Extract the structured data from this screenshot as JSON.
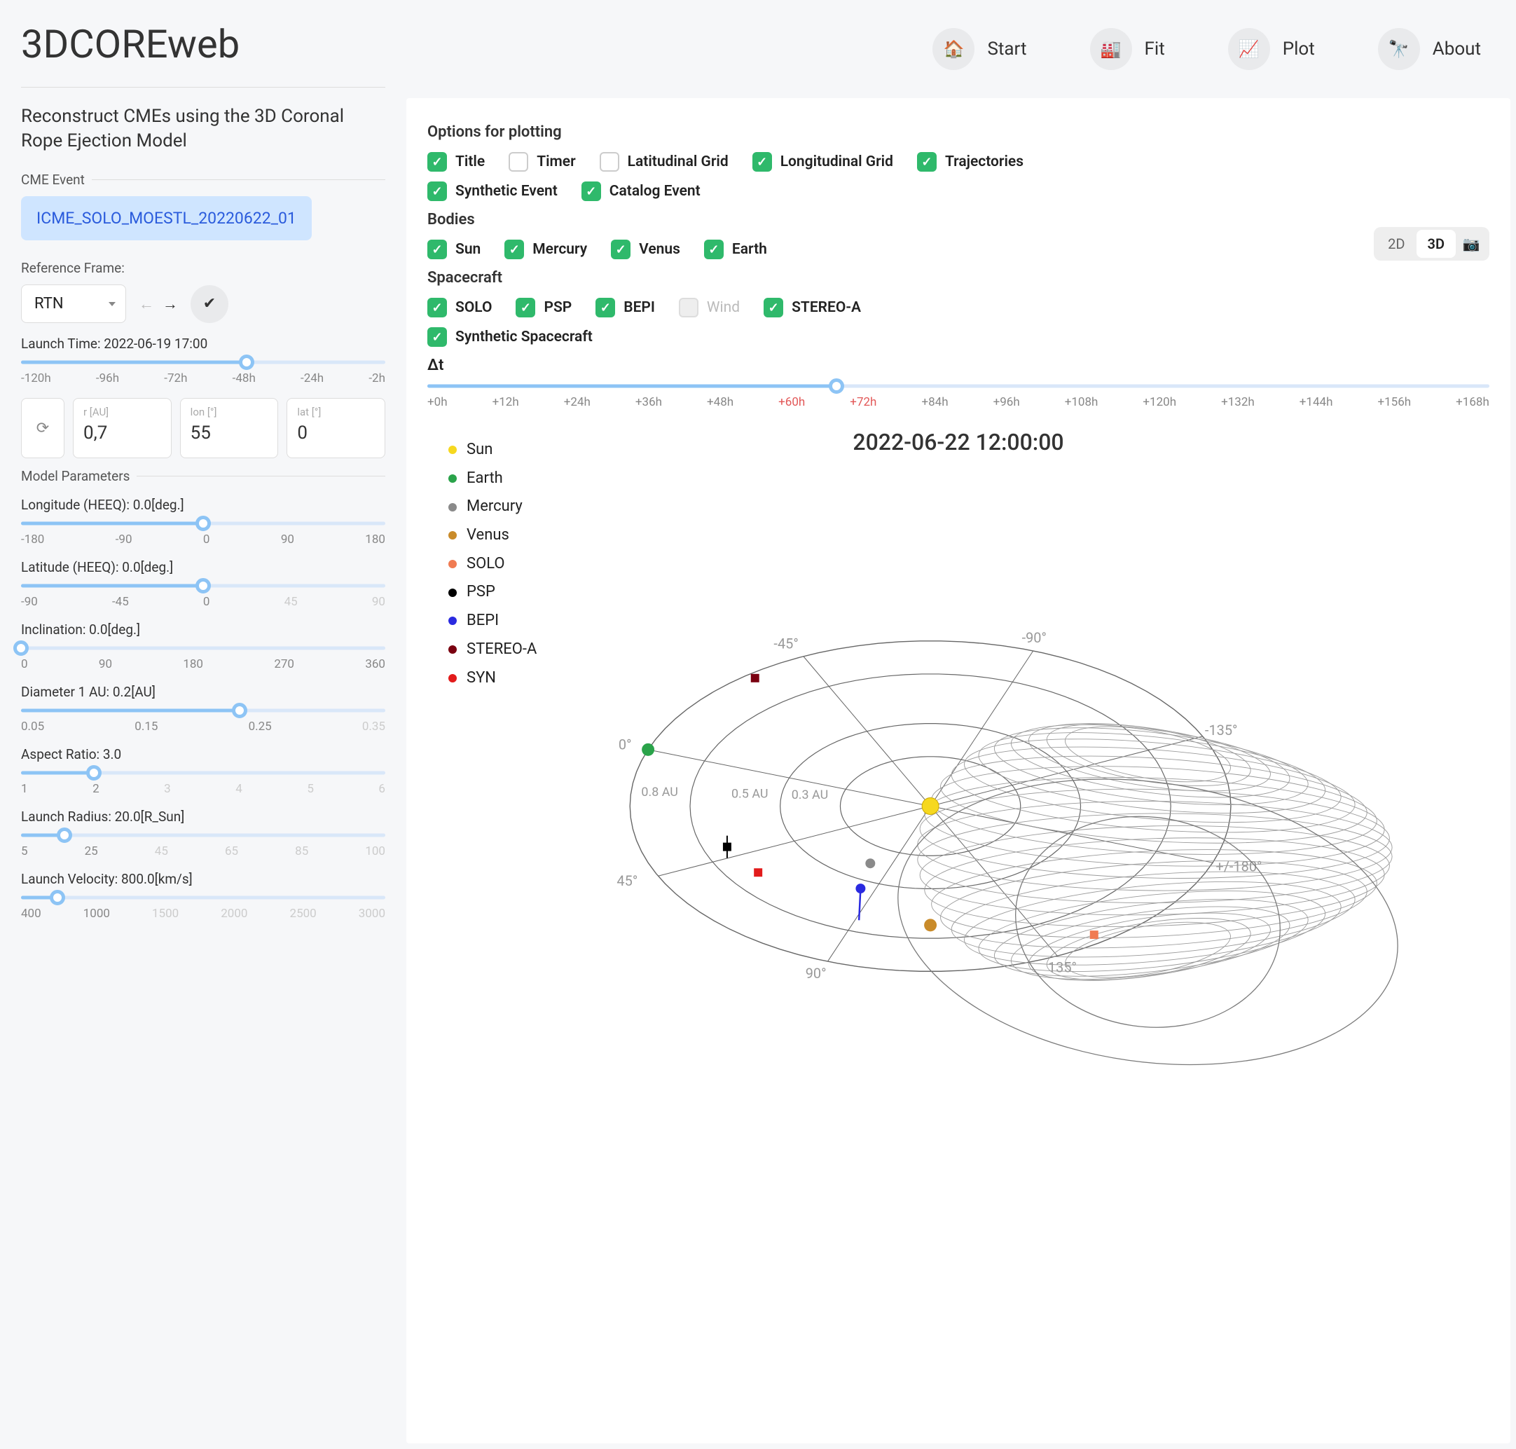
{
  "app_title": "3DCOREweb",
  "tagline": "Reconstruct CMEs using the 3D Coronal Rope Ejection Model",
  "nav": {
    "start": "Start",
    "fit": "Fit",
    "plot": "Plot",
    "about": "About"
  },
  "sidebar": {
    "cme_event_label": "CME Event",
    "cme_event_value": "ICME_SOLO_MOESTL_20220622_01",
    "ref_frame_label": "Reference Frame:",
    "ref_frame_value": "RTN",
    "launch_time": {
      "label": "Launch Time: 2022-06-19 17:00",
      "ticks": [
        "-120h",
        "-96h",
        "-72h",
        "-48h",
        "-24h",
        "-2h"
      ],
      "fill_pct": 62,
      "thumb_pct": 62
    },
    "coords": {
      "r_label": "r [AU]",
      "r_value": "0,7",
      "lon_label": "lon [°]",
      "lon_value": "55",
      "lat_label": "lat [°]",
      "lat_value": "0"
    },
    "model_params_label": "Model Parameters",
    "params": [
      {
        "label": "Longitude (HEEQ): 0.0[deg.]",
        "ticks": [
          "-180",
          "-90",
          "0",
          "90",
          "180"
        ],
        "fill_pct": 50,
        "thumb_pct": 50
      },
      {
        "label": "Latitude (HEEQ): 0.0[deg.]",
        "ticks": [
          "-90",
          "-45",
          "0",
          "45",
          "90"
        ],
        "fill_pct": 50,
        "thumb_pct": 50,
        "fade_after": 2
      },
      {
        "label": "Inclination: 0.0[deg.]",
        "ticks": [
          "0",
          "90",
          "180",
          "270",
          "360"
        ],
        "fill_pct": 0,
        "thumb_pct": 0
      },
      {
        "label": "Diameter 1 AU: 0.2[AU]",
        "ticks": [
          "0.05",
          "0.15",
          "0.25",
          "0.35"
        ],
        "fill_pct": 60,
        "thumb_pct": 60,
        "fade_after": 2
      },
      {
        "label": "Aspect Ratio: 3.0",
        "ticks": [
          "1",
          "2",
          "3",
          "4",
          "5",
          "6"
        ],
        "fill_pct": 20,
        "thumb_pct": 20,
        "fade_after": 1
      },
      {
        "label": "Launch Radius: 20.0[R_Sun]",
        "ticks": [
          "5",
          "25",
          "45",
          "65",
          "85",
          "100"
        ],
        "fill_pct": 12,
        "thumb_pct": 12,
        "fade_after": 1
      },
      {
        "label": "Launch Velocity: 800.0[km/s]",
        "ticks": [
          "400",
          "1000",
          "1500",
          "2000",
          "2500",
          "3000"
        ],
        "fill_pct": 10,
        "thumb_pct": 10,
        "fade_after": 1
      }
    ]
  },
  "options": {
    "title_label": "Options for plotting",
    "row1": [
      {
        "label": "Title",
        "checked": true
      },
      {
        "label": "Timer",
        "checked": false
      },
      {
        "label": "Latitudinal Grid",
        "checked": false
      },
      {
        "label": "Longitudinal Grid",
        "checked": true
      },
      {
        "label": "Trajectories",
        "checked": true
      }
    ],
    "row2": [
      {
        "label": "Synthetic Event",
        "checked": true
      },
      {
        "label": "Catalog Event",
        "checked": true
      }
    ],
    "bodies_label": "Bodies",
    "bodies": [
      {
        "label": "Sun",
        "checked": true
      },
      {
        "label": "Mercury",
        "checked": true
      },
      {
        "label": "Venus",
        "checked": true
      },
      {
        "label": "Earth",
        "checked": true
      }
    ],
    "spacecraft_label": "Spacecraft",
    "spacecraft": [
      {
        "label": "SOLO",
        "checked": true
      },
      {
        "label": "PSP",
        "checked": true
      },
      {
        "label": "BEPI",
        "checked": true
      },
      {
        "label": "Wind",
        "checked": false,
        "disabled": true
      },
      {
        "label": "STEREO-A",
        "checked": true
      }
    ],
    "synthetic_sc": {
      "label": "Synthetic Spacecraft",
      "checked": true
    },
    "toggle2d": "2D",
    "toggle3d": "3D"
  },
  "dt": {
    "label": "Δt",
    "ticks": [
      "+0h",
      "+12h",
      "+24h",
      "+36h",
      "+48h",
      "+60h",
      "+72h",
      "+84h",
      "+96h",
      "+108h",
      "+120h",
      "+132h",
      "+144h",
      "+156h",
      "+168h"
    ],
    "warn_indices": [
      5,
      6
    ],
    "fill_pct": 38.5,
    "thumb_pct": 38.5
  },
  "plot": {
    "title": "2022-06-22 12:00:00",
    "legend": [
      {
        "name": "Sun",
        "color": "#f6d81f"
      },
      {
        "name": "Earth",
        "color": "#2aa34a"
      },
      {
        "name": "Mercury",
        "color": "#8a8a8a"
      },
      {
        "name": "Venus",
        "color": "#c98b2a"
      },
      {
        "name": "SOLO",
        "color": "#f07b52"
      },
      {
        "name": "PSP",
        "color": "#000000"
      },
      {
        "name": "BEPI",
        "color": "#2a2ae0"
      },
      {
        "name": "STEREO-A",
        "color": "#7a0010"
      },
      {
        "name": "SYN",
        "color": "#e21b1b"
      }
    ],
    "angle_labels": [
      "0°",
      "45°",
      "90°",
      "135°",
      "+/-180°",
      "-135°",
      "-90°",
      "-45°"
    ],
    "ring_labels": [
      "0.3 AU",
      "0.5 AU",
      "0.8 AU"
    ]
  },
  "chart_data": {
    "type": "scatter",
    "title": "2022-06-22 12:00:00",
    "projection": "heliocentric_polar_topdown",
    "radial_unit": "AU",
    "angular_unit": "deg_HEEQ_longitude",
    "angle_ticks": [
      0,
      45,
      90,
      135,
      180,
      -135,
      -90,
      -45
    ],
    "radial_ticks": [
      0.3,
      0.5,
      0.8
    ],
    "bodies": [
      {
        "name": "Sun",
        "r": 0.0,
        "lon": 0,
        "color": "#f6d81f"
      },
      {
        "name": "Earth",
        "r": 1.0,
        "lon": 0,
        "color": "#2aa34a"
      },
      {
        "name": "Mercury",
        "r": 0.4,
        "lon": 80,
        "color": "#8a8a8a"
      },
      {
        "name": "Venus",
        "r": 0.72,
        "lon": 110,
        "color": "#c98b2a"
      },
      {
        "name": "SOLO",
        "r": 0.95,
        "lon": 145,
        "color": "#f07b52"
      },
      {
        "name": "PSP",
        "r": 0.72,
        "lon": 40,
        "color": "#000000"
      },
      {
        "name": "BEPI",
        "r": 0.55,
        "lon": 85,
        "color": "#2a2ae0"
      },
      {
        "name": "STEREO-A",
        "r": 0.97,
        "lon": -33,
        "color": "#7a0010"
      },
      {
        "name": "SYN",
        "r": 0.7,
        "lon": 55,
        "color": "#e21b1b"
      }
    ],
    "flux_rope": {
      "apex_r_au": 1.0,
      "apex_lon_deg": 125,
      "half_width_deg": 45
    }
  }
}
